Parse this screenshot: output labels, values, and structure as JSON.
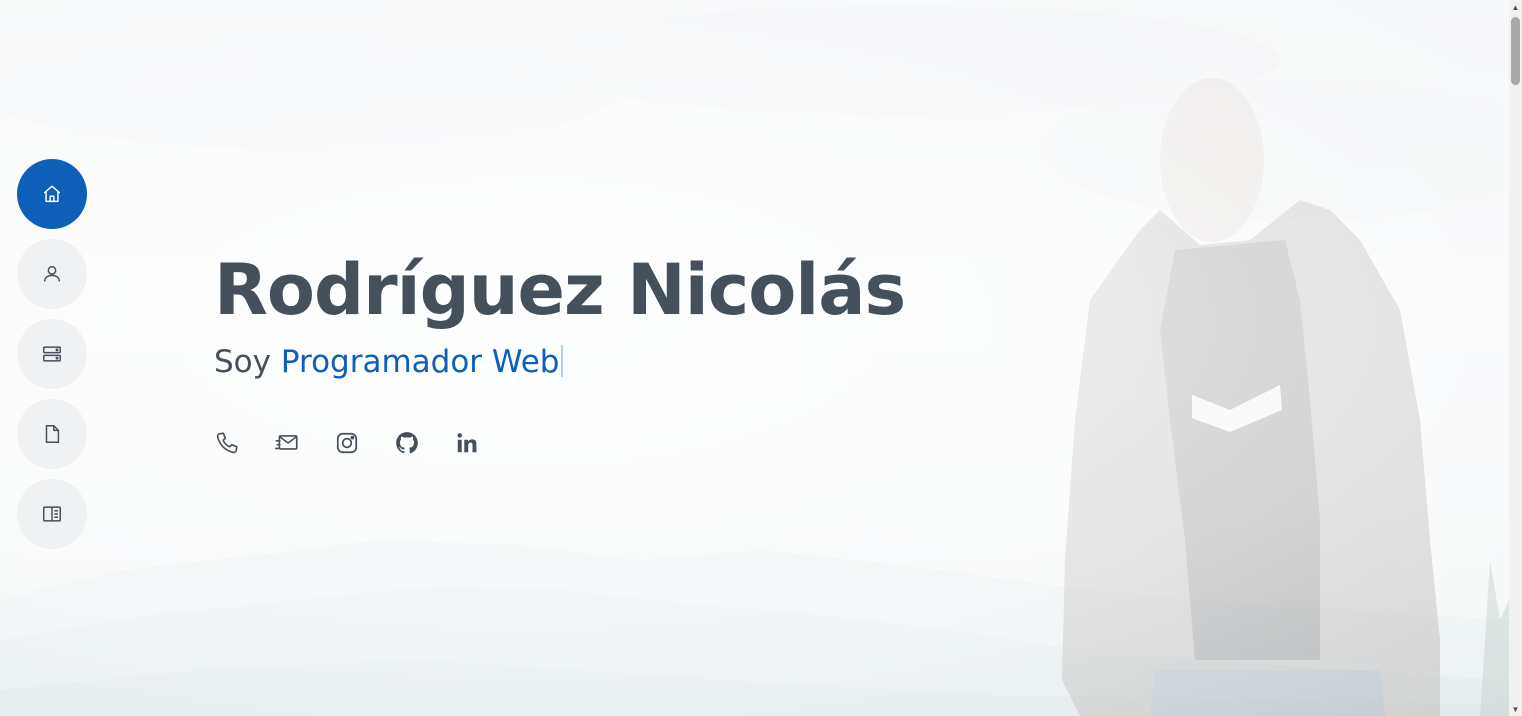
{
  "hero": {
    "name": "Rodríguez Nicolás",
    "tagline_prefix": "Soy",
    "tagline_typed": "Programador Web"
  },
  "nav": {
    "items": [
      {
        "name": "home",
        "icon": "home-icon",
        "active": true
      },
      {
        "name": "about",
        "icon": "person-icon",
        "active": false
      },
      {
        "name": "services",
        "icon": "server-icon",
        "active": false
      },
      {
        "name": "resume",
        "icon": "file-icon",
        "active": false
      },
      {
        "name": "portfolio",
        "icon": "book-icon",
        "active": false
      }
    ]
  },
  "social": [
    {
      "name": "phone",
      "icon": "phone-icon"
    },
    {
      "name": "email",
      "icon": "email-icon"
    },
    {
      "name": "instagram",
      "icon": "instagram-icon"
    },
    {
      "name": "github",
      "icon": "github-icon"
    },
    {
      "name": "linkedin",
      "icon": "linkedin-icon"
    }
  ],
  "colors": {
    "accent": "#0d5fb8",
    "text": "#45505b",
    "nav_bg": "#eff1f3"
  }
}
